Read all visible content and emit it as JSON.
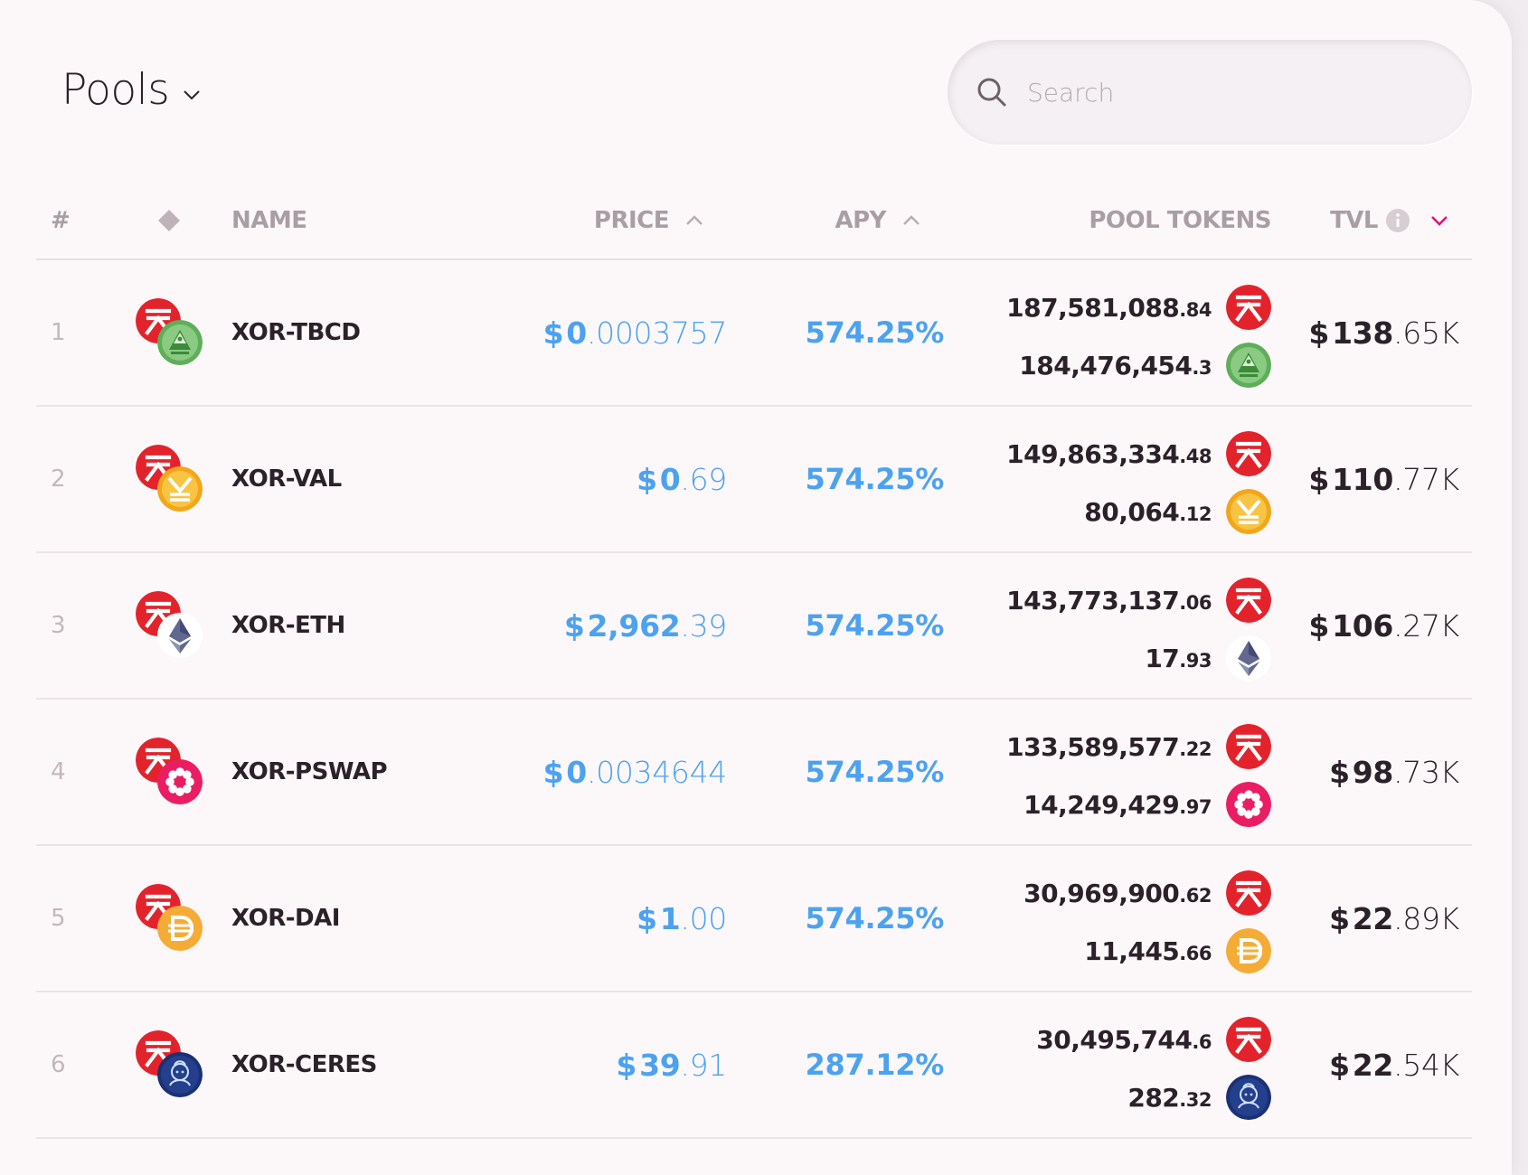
{
  "header": {
    "title": "Pools",
    "search_placeholder": "Search"
  },
  "columns": {
    "num": "#",
    "name": "NAME",
    "price": "PRICE",
    "apy": "APY",
    "pool_tokens": "POOL TOKENS",
    "tvl": "TVL"
  },
  "colors": {
    "accent_blue": "#4ca2f0",
    "accent_pink": "#e0137c",
    "xor_red": "#e3232c"
  },
  "rows": [
    {
      "num": "1",
      "name": "XOR-TBCD",
      "price_cur": "$",
      "price_int": "0",
      "price_dec": ".0003757",
      "apy": "574.25%",
      "pool_a_int": "187,581,088",
      "pool_a_dec": ".84",
      "pool_b_int": "184,476,454",
      "pool_b_dec": ".3",
      "tvl_cur": "$",
      "tvl_int": "138",
      "tvl_dec": ".65K",
      "token_a_icon": "xor-icon",
      "token_b_icon": "tbcd-icon"
    },
    {
      "num": "2",
      "name": "XOR-VAL",
      "price_cur": "$",
      "price_int": "0",
      "price_dec": ".69",
      "apy": "574.25%",
      "pool_a_int": "149,863,334",
      "pool_a_dec": ".48",
      "pool_b_int": "80,064",
      "pool_b_dec": ".12",
      "tvl_cur": "$",
      "tvl_int": "110",
      "tvl_dec": ".77K",
      "token_a_icon": "xor-icon",
      "token_b_icon": "val-icon"
    },
    {
      "num": "3",
      "name": "XOR-ETH",
      "price_cur": "$",
      "price_int": "2,962",
      "price_dec": ".39",
      "apy": "574.25%",
      "pool_a_int": "143,773,137",
      "pool_a_dec": ".06",
      "pool_b_int": "17",
      "pool_b_dec": ".93",
      "tvl_cur": "$",
      "tvl_int": "106",
      "tvl_dec": ".27K",
      "token_a_icon": "xor-icon",
      "token_b_icon": "eth-icon"
    },
    {
      "num": "4",
      "name": "XOR-PSWAP",
      "price_cur": "$",
      "price_int": "0",
      "price_dec": ".0034644",
      "apy": "574.25%",
      "pool_a_int": "133,589,577",
      "pool_a_dec": ".22",
      "pool_b_int": "14,249,429",
      "pool_b_dec": ".97",
      "tvl_cur": "$",
      "tvl_int": "98",
      "tvl_dec": ".73K",
      "token_a_icon": "xor-icon",
      "token_b_icon": "pswap-icon"
    },
    {
      "num": "5",
      "name": "XOR-DAI",
      "price_cur": "$",
      "price_int": "1",
      "price_dec": ".00",
      "apy": "574.25%",
      "pool_a_int": "30,969,900",
      "pool_a_dec": ".62",
      "pool_b_int": "11,445",
      "pool_b_dec": ".66",
      "tvl_cur": "$",
      "tvl_int": "22",
      "tvl_dec": ".89K",
      "token_a_icon": "xor-icon",
      "token_b_icon": "dai-icon"
    },
    {
      "num": "6",
      "name": "XOR-CERES",
      "price_cur": "$",
      "price_int": "39",
      "price_dec": ".91",
      "apy": "287.12%",
      "pool_a_int": "30,495,744",
      "pool_a_dec": ".6",
      "pool_b_int": "282",
      "pool_b_dec": ".32",
      "tvl_cur": "$",
      "tvl_int": "22",
      "tvl_dec": ".54K",
      "token_a_icon": "xor-icon",
      "token_b_icon": "ceres-icon"
    }
  ]
}
